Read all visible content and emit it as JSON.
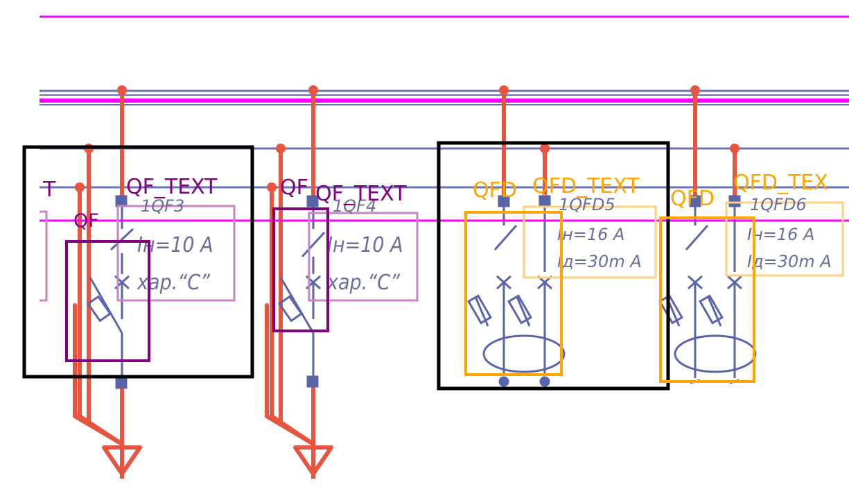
{
  "colors": {
    "magenta": "#ff00ff",
    "bus_blue": "#6b72b0",
    "wire_red": "#e8553e",
    "device_blue": "#5a64a8",
    "spec_gray": "#6a6f9a",
    "qf_purple": "#800080",
    "qf_box_light": "#c387c3",
    "qfd_orange": "#ffa500",
    "qfd_box_light": "#ffcf82",
    "group_black": "#000000"
  },
  "annotations": {
    "t_label": "T",
    "qf_label_1": "QF",
    "qf_text_1": "QF_TEXT",
    "qf_label_2": "QF",
    "qf_text_2": "QF_TEXT",
    "qfd_label_1": "QFD",
    "qfd_text_1": "QFD_TEXT",
    "qfd_label_2": "QFD",
    "qfd_text_2": "QFD_TEX"
  },
  "breakers": [
    {
      "name": "1QF3",
      "current": "Iн=10 А",
      "characteristic": "хар.“С”"
    },
    {
      "name": "1QF4",
      "current": "Iн=10 А",
      "characteristic": "хар.“С”"
    }
  ],
  "rcbos": [
    {
      "name": "1QFD5",
      "current": "Iн=16 А",
      "leakage": "Iд=30m А"
    },
    {
      "name": "1QFD6",
      "current": "Iн=16 А",
      "leakage": "Iд=30m А"
    }
  ]
}
